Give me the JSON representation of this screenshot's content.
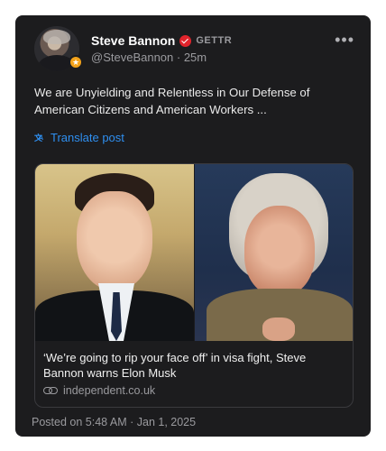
{
  "post": {
    "author_name": "Steve Bannon",
    "platform": "GETTR",
    "handle_time": "@SteveBannon · 25m",
    "text": "We are Unyielding and Relentless in Our Defense of American Citizens and American Workers ...",
    "translate_label": "Translate post",
    "more_label": "•••",
    "posted_on": "Posted on 5:48 AM · Jan 1, 2025"
  },
  "link_card": {
    "title": "‘We’re going to rip your face off’ in visa fight, Steve Bannon warns Elon Musk",
    "domain": "independent.co.uk"
  },
  "icons": {
    "verified": "verified-badge-icon",
    "avatar_badge": "gold-badge-icon",
    "translate": "translate-icon",
    "link": "link-chain-icon",
    "more": "more-dots-icon"
  },
  "colors": {
    "card_bg": "#1c1c1e",
    "accent_blue": "#2f8ff0",
    "verified_red": "#e0242c",
    "secondary_text": "#9a9a9e"
  }
}
